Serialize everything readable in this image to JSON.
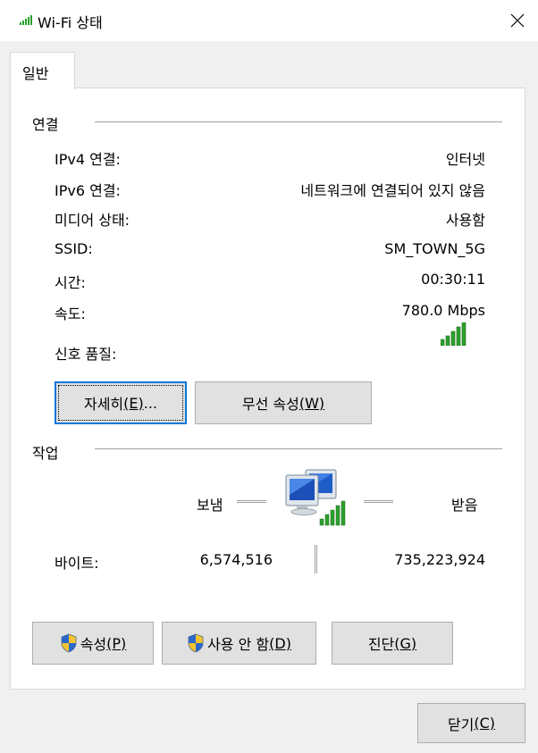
{
  "window": {
    "title": "Wi-Fi 상태"
  },
  "tabs": [
    {
      "label": "일반"
    }
  ],
  "connection": {
    "heading": "연결",
    "rows": [
      {
        "label": "IPv4 연결:",
        "value": "인터넷"
      },
      {
        "label": "IPv6 연결:",
        "value": "네트워크에 연결되어 있지 않음"
      },
      {
        "label": "미디어 상태:",
        "value": "사용함"
      },
      {
        "label": "SSID:",
        "value": "SM_TOWN_5G"
      },
      {
        "label": "시간:",
        "value": "00:30:11"
      },
      {
        "label": "속도:",
        "value": "780.0 Mbps"
      }
    ],
    "signal_label": "신호 품질:",
    "signal_bars": 5,
    "signal_bars_max": 5,
    "details_button": {
      "label": "자세히",
      "mnemonic": "(E)",
      "suffix": "..."
    },
    "wireless_button": {
      "label": "무선 속성",
      "mnemonic": "(W)"
    }
  },
  "activity": {
    "heading": "작업",
    "sent_label": "보냄",
    "received_label": "받음",
    "bytes_label": "바이트:",
    "bytes_sent": "6,574,516",
    "bytes_received": "735,223,924"
  },
  "actions": [
    {
      "label": "속성",
      "mnemonic": "(P)",
      "icon": "uac-shield-icon"
    },
    {
      "label": "사용 안 함",
      "mnemonic": "(D)",
      "icon": "uac-shield-icon"
    },
    {
      "label": "진단",
      "mnemonic": "(G)"
    }
  ],
  "footer": {
    "close_button": {
      "label": "닫기",
      "mnemonic": "(C)"
    }
  },
  "colors": {
    "signal_green": "#2ca02c",
    "focus_blue": "#0078d7",
    "button_face": "#e1e1e1"
  }
}
